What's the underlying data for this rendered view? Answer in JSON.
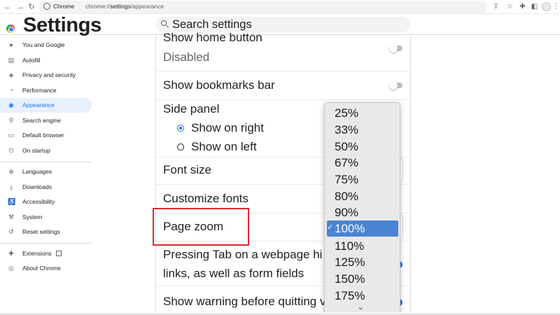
{
  "browser": {
    "site_label": "Chrome",
    "url_scheme": "chrome://",
    "url_host": "settings",
    "url_path": "/appearance",
    "icons": [
      "back-icon",
      "forward-icon",
      "reload-icon",
      "share-icon",
      "star-icon",
      "extensions-icon",
      "side-panel-icon",
      "profile-icon",
      "menu-icon"
    ]
  },
  "header": {
    "title": "Settings",
    "search_placeholder": "Search settings"
  },
  "sidebar": {
    "items": [
      {
        "label": "You and Google",
        "icon": "person-icon"
      },
      {
        "label": "Autofill",
        "icon": "clipboard-icon"
      },
      {
        "label": "Privacy and security",
        "icon": "shield-icon"
      },
      {
        "label": "Performance",
        "icon": "gauge-icon"
      },
      {
        "label": "Appearance",
        "icon": "palette-icon",
        "active": true
      },
      {
        "label": "Search engine",
        "icon": "search-icon"
      },
      {
        "label": "Default browser",
        "icon": "browser-icon"
      },
      {
        "label": "On startup",
        "icon": "power-icon"
      },
      {
        "label": "Languages",
        "icon": "globe-icon"
      },
      {
        "label": "Downloads",
        "icon": "download-icon"
      },
      {
        "label": "Accessibility",
        "icon": "accessibility-icon"
      },
      {
        "label": "System",
        "icon": "wrench-icon"
      },
      {
        "label": "Reset settings",
        "icon": "reset-icon"
      },
      {
        "label": "Extensions",
        "icon": "puzzle-icon"
      },
      {
        "label": "About Chrome",
        "icon": "chrome-icon"
      }
    ]
  },
  "main": {
    "home_button": {
      "label": "Show home button",
      "value": "Disabled"
    },
    "bookmarks_bar": {
      "label": "Show bookmarks bar"
    },
    "side_panel": {
      "label": "Side panel",
      "options": [
        "Show on right",
        "Show on left"
      ],
      "selected": "Show on right"
    },
    "font_size": {
      "label": "Font size"
    },
    "customize_fonts": {
      "label": "Customize fonts"
    },
    "page_zoom": {
      "label": "Page zoom"
    },
    "tab_highlight": {
      "line1": "Pressing Tab on a webpage hi",
      "line2": "links, as well as form fields"
    },
    "quit_warning": {
      "label": "Show warning before quitting v"
    }
  },
  "zoom_dropdown": {
    "options": [
      "25%",
      "33%",
      "50%",
      "67%",
      "75%",
      "80%",
      "90%",
      "100%",
      "110%",
      "125%",
      "150%",
      "175%"
    ],
    "selected": "100%",
    "check_mark": "✓",
    "more_indicator": "⌄"
  },
  "colors": {
    "accent": "#1a73e8",
    "active_bg": "#e8f0fe",
    "highlight_box": "#e3262b",
    "dropdown_selected": "#4a84d4"
  }
}
